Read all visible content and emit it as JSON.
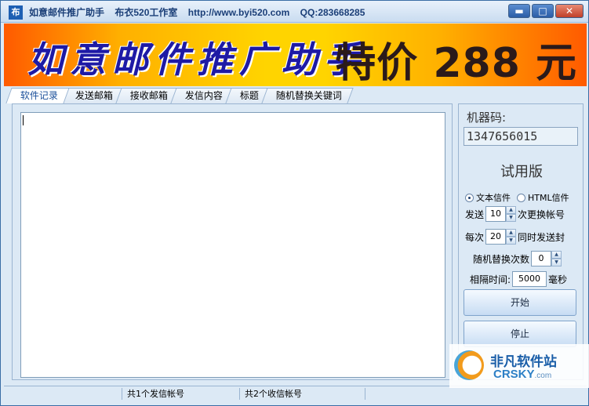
{
  "titlebar": {
    "icon_char": "布",
    "title": "如意邮件推广助手",
    "studio": "布衣520工作室",
    "url": "http://www.byi520.com",
    "qq": "QQ:283668285",
    "min_symbol": "▬",
    "max_symbol": "□",
    "close_symbol": "✕"
  },
  "banner": {
    "left_text": "如意邮件推广助手",
    "right_text": "特价 288 元"
  },
  "tabs": [
    "软件记录",
    "发送邮箱",
    "接收邮箱",
    "发信内容",
    "标题",
    "随机替换关键词"
  ],
  "side": {
    "machine_code_label": "机器码:",
    "machine_code": "1347656015",
    "edition": "试用版",
    "radio_text": "文本信件",
    "radio_html": "HTML信件",
    "send_prefix": "发送",
    "send_value": "10",
    "send_suffix": "次更换帐号",
    "each_prefix": "每次",
    "each_value": "20",
    "each_suffix": "同时发送封",
    "random_label": "随机替换次数",
    "random_value": "0",
    "interval_label": "相隔时间:",
    "interval_value": "5000",
    "interval_unit": "毫秒",
    "start": "开始",
    "stop": "停止"
  },
  "status": {
    "send_accounts": "共1个发信帐号",
    "recv_accounts": "共2个收信帐号"
  },
  "watermark": {
    "cn": "非凡软件站",
    "en": "CRSKY",
    "en_suffix": ".com"
  }
}
